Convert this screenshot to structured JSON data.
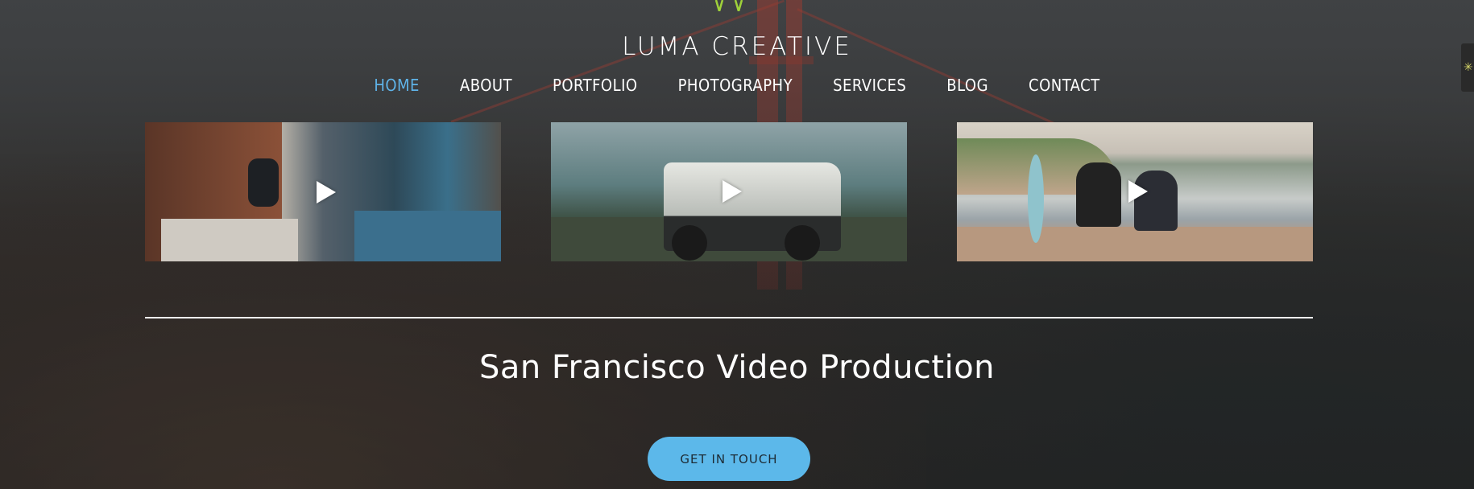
{
  "brand": {
    "name": "LUMA CREATIVE"
  },
  "nav": {
    "items": [
      {
        "label": "HOME",
        "active": true
      },
      {
        "label": "ABOUT"
      },
      {
        "label": "PORTFOLIO"
      },
      {
        "label": "PHOTOGRAPHY"
      },
      {
        "label": "SERVICES"
      },
      {
        "label": "BLOG"
      },
      {
        "label": "CONTACT"
      }
    ]
  },
  "videos": [
    {
      "icon": "play-icon"
    },
    {
      "icon": "play-icon"
    },
    {
      "icon": "play-icon"
    }
  ],
  "hero": {
    "headline": "San Francisco Video Production",
    "cta_label": "GET IN TOUCH"
  },
  "colors": {
    "accent": "#5fb3e8",
    "button": "#5cb8ea",
    "text": "#ffffff"
  }
}
